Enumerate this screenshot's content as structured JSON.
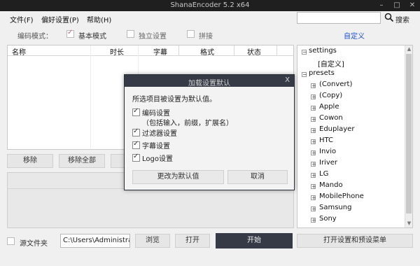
{
  "window": {
    "title": "ShanaEncoder 5.2 x64",
    "controls": {
      "minimize": "–",
      "maximize": "□",
      "close": "✕"
    }
  },
  "menu": {
    "items": [
      "文件(F)",
      "偏好设置(P)",
      "帮助(H)"
    ]
  },
  "search": {
    "value": "",
    "button_label": "搜索",
    "icon": "search-icon"
  },
  "mode_bar": {
    "label": "编码模式：",
    "options": [
      {
        "label": "基本模式",
        "checked": true
      },
      {
        "label": "独立设置",
        "checked": false
      },
      {
        "label": "拼接",
        "checked": false
      }
    ],
    "custom_link": "自定义"
  },
  "file_list": {
    "columns": [
      "名称",
      "时长",
      "字幕",
      "格式",
      "状态"
    ]
  },
  "list_buttons": [
    "移除",
    "移除全部"
  ],
  "tree": {
    "roots": [
      {
        "label": "settings",
        "expanded": true,
        "children": [
          "[自定义]"
        ]
      },
      {
        "label": "presets",
        "expanded": true,
        "children": [
          "(Convert)",
          "(Copy)",
          "Apple",
          "Cowon",
          "Eduplayer",
          "HTC",
          "Invio",
          "Iriver",
          "LG",
          "Mando",
          "MobilePhone",
          "Samsung",
          "Sony"
        ]
      }
    ]
  },
  "bottom_bar": {
    "source_folder_label": "源文件夹",
    "source_folder_checked": false,
    "path_value": "C:\\Users\\Administrator\\",
    "browse_label": "浏览",
    "open_label": "打开",
    "start_label": "开始",
    "settings_menu_label": "打开设置和预设菜单"
  },
  "dialog": {
    "title": "加载设置默认",
    "close": "X",
    "message": "所选项目被设置为默认值。",
    "options": [
      {
        "label": "编码设置",
        "sub": "（包括输入，前缀，扩展名）",
        "checked": true
      },
      {
        "label": "过滤器设置",
        "checked": true
      },
      {
        "label": "字幕设置",
        "checked": true
      },
      {
        "label": "Logo设置",
        "checked": true
      }
    ],
    "confirm_label": "更改为默认值",
    "cancel_label": "取消"
  },
  "colors": {
    "titlebar": "#1f1f1f",
    "dialog_titlebar": "#353a46",
    "start_button": "#353a46",
    "link": "#1a4fcf",
    "check_accent": "#c0608a"
  }
}
